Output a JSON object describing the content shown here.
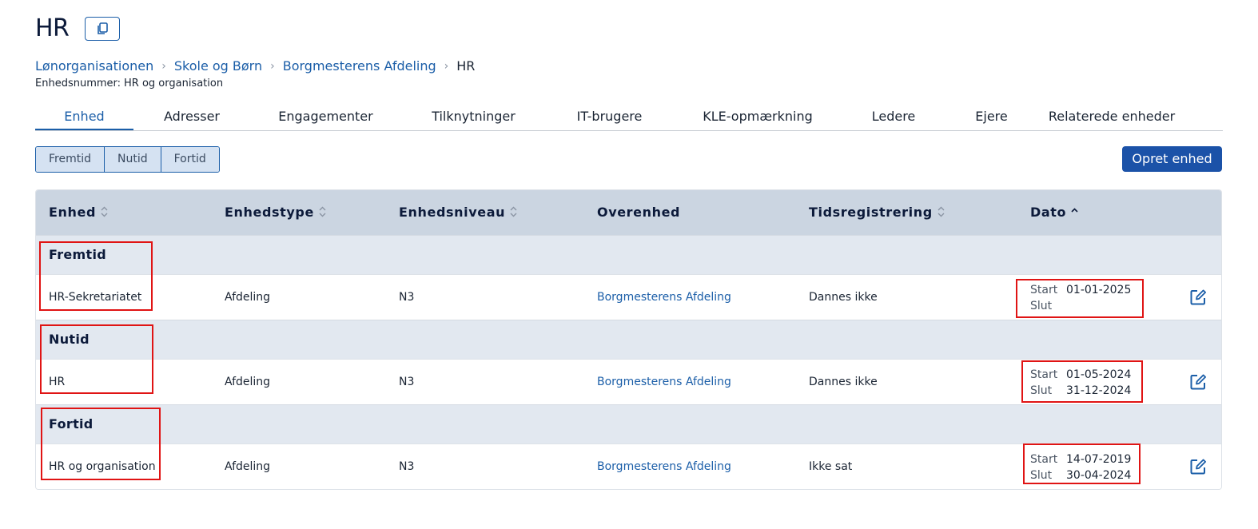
{
  "page": {
    "title": "HR"
  },
  "breadcrumb": [
    {
      "label": "Lønorganisationen",
      "link": true
    },
    {
      "label": "Skole og Børn",
      "link": true
    },
    {
      "label": "Borgmesterens Afdeling",
      "link": true
    },
    {
      "label": "HR",
      "link": false
    }
  ],
  "unit_number": {
    "label": "Enhedsnummer:",
    "value": "HR og organisation"
  },
  "tabs": [
    "Enhed",
    "Adresser",
    "Engagementer",
    "Tilknytninger",
    "IT-brugere",
    "KLE-opmærkning",
    "Ledere",
    "Ejere",
    "Relaterede enheder"
  ],
  "active_tab": "Enhed",
  "time_filter": [
    "Fremtid",
    "Nutid",
    "Fortid"
  ],
  "create_button": "Opret enhed",
  "table": {
    "columns": [
      "Enhed",
      "Enhedstype",
      "Enhedsniveau",
      "Overenhed",
      "Tidsregistrering",
      "Dato"
    ],
    "start_label": "Start",
    "end_label": "Slut",
    "groups": [
      {
        "label": "Fremtid",
        "rows": [
          {
            "unit": "HR-Sekretariatet",
            "type": "Afdeling",
            "level": "N3",
            "parent": "Borgmesterens Afdeling",
            "time_registration": "Dannes ikke",
            "start": "01-01-2025",
            "end": ""
          }
        ]
      },
      {
        "label": "Nutid",
        "rows": [
          {
            "unit": "HR",
            "type": "Afdeling",
            "level": "N3",
            "parent": "Borgmesterens Afdeling",
            "time_registration": "Dannes ikke",
            "start": "01-05-2024",
            "end": "31-12-2024"
          }
        ]
      },
      {
        "label": "Fortid",
        "rows": [
          {
            "unit": "HR og organisation",
            "type": "Afdeling",
            "level": "N3",
            "parent": "Borgmesterens Afdeling",
            "time_registration": "Ikke sat",
            "start": "14-07-2019",
            "end": "30-04-2024"
          }
        ]
      }
    ]
  },
  "colors": {
    "primary": "#1b52a8",
    "link": "#1b5ea8",
    "header_bg": "#cbd5e1",
    "group_bg": "#e2e8f0",
    "highlight": "#e01414"
  }
}
